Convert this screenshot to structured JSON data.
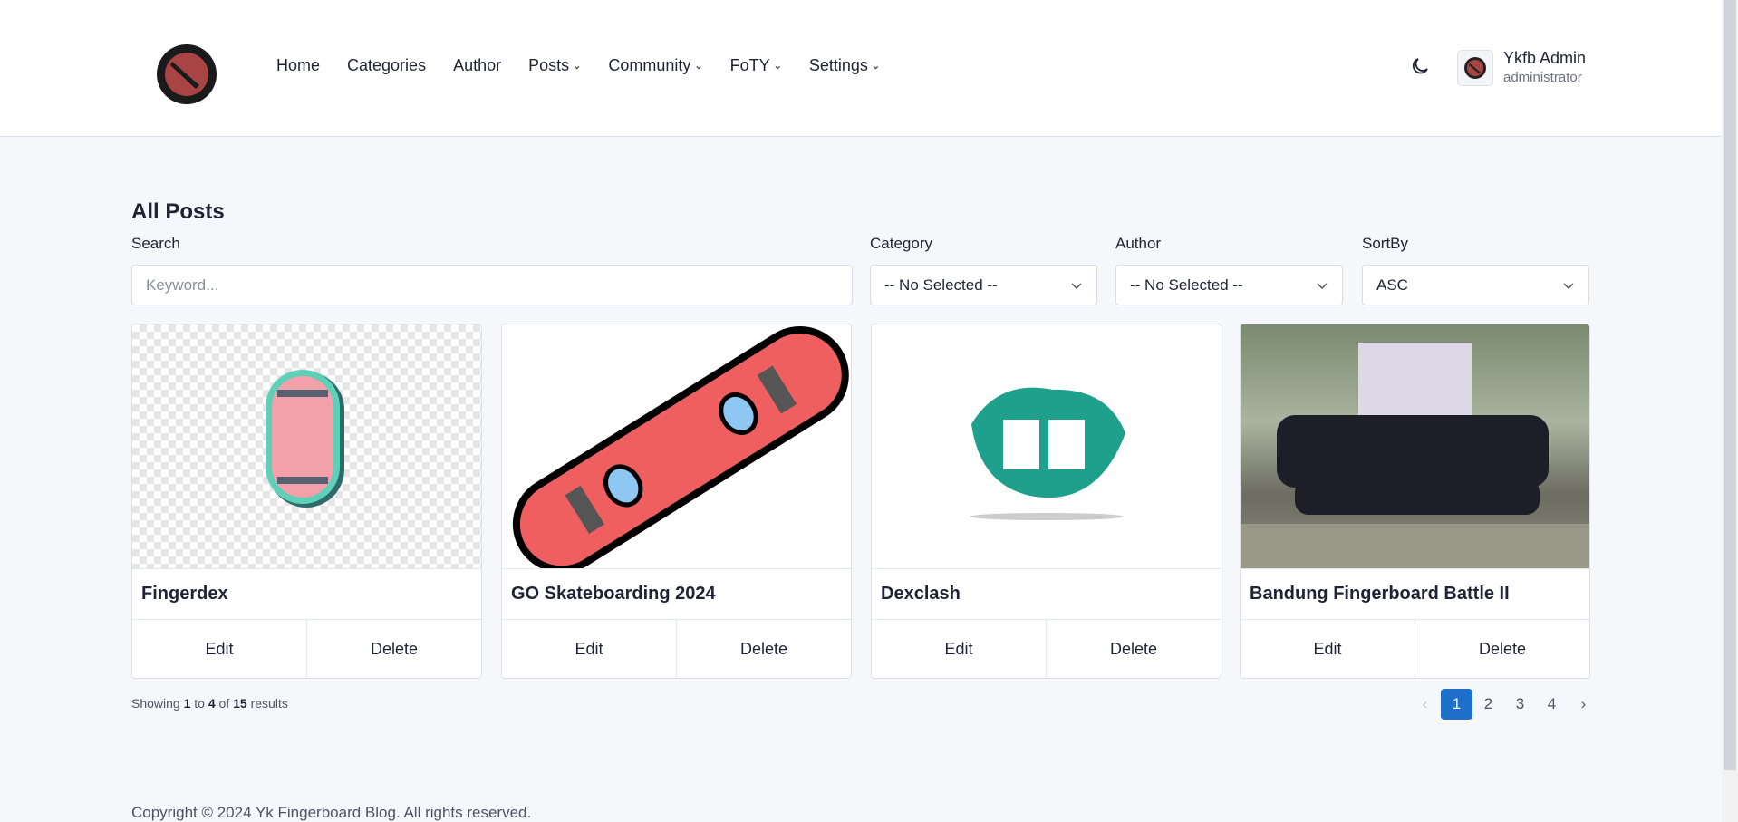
{
  "header": {
    "nav": [
      "Home",
      "Categories",
      "Author",
      "Posts",
      "Community",
      "FoTY",
      "Settings"
    ],
    "user_name": "Ykfb Admin",
    "user_role": "administrator"
  },
  "page": {
    "title": "All Posts",
    "search_label": "Search",
    "search_placeholder": "Keyword...",
    "category_label": "Category",
    "category_value": "-- No Selected --",
    "author_label": "Author",
    "author_value": "-- No Selected --",
    "sort_label": "SortBy",
    "sort_value": "ASC"
  },
  "posts": [
    {
      "title": "Fingerdex",
      "edit": "Edit",
      "delete": "Delete"
    },
    {
      "title": "GO Skateboarding 2024",
      "edit": "Edit",
      "delete": "Delete"
    },
    {
      "title": "Dexclash",
      "edit": "Edit",
      "delete": "Delete"
    },
    {
      "title": "Bandung Fingerboard Battle II",
      "edit": "Edit",
      "delete": "Delete"
    }
  ],
  "pagination": {
    "showing": "Showing",
    "from": "1",
    "to_word": "to",
    "to": "4",
    "of_word": "of",
    "total": "15",
    "results": "results",
    "prev": "‹",
    "pages": [
      "1",
      "2",
      "3",
      "4"
    ],
    "next": "›",
    "current": "1"
  },
  "footer": {
    "copyright": "Copyright © 2024 Yk Fingerboard Blog. All rights reserved."
  },
  "colors": {
    "accent": "#1d6fc9",
    "background": "#f5f7fa"
  }
}
